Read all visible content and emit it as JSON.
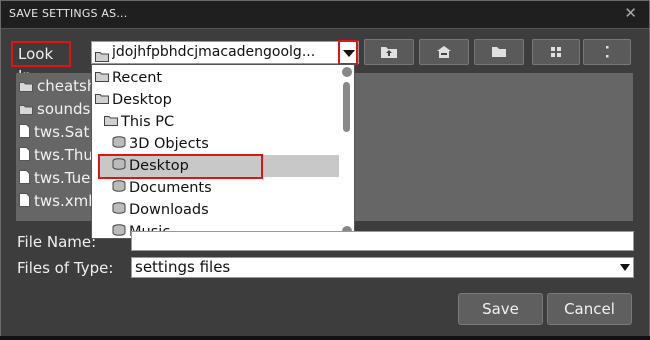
{
  "dialog": {
    "title": "SAVE SETTINGS AS...",
    "close_glyph": "✕"
  },
  "lookin": {
    "label": "Look In:",
    "value": "jdojhfpbhdcjmacadengoolg..."
  },
  "files": [
    {
      "name": "cheatsh",
      "type": "folder"
    },
    {
      "name": "sounds",
      "type": "folder"
    },
    {
      "name": "tws.Sat",
      "type": "file"
    },
    {
      "name": "tws.Thu",
      "type": "file"
    },
    {
      "name": "tws.Tue",
      "type": "file"
    },
    {
      "name": "tws.xml",
      "type": "file"
    }
  ],
  "dropdown": {
    "items": [
      {
        "label": "Recent",
        "icon": "folder-icon"
      },
      {
        "label": "Desktop",
        "icon": "folder-icon"
      },
      {
        "label": "This PC",
        "icon": "folder-icon"
      },
      {
        "label": "3D Objects",
        "icon": "drive-icon"
      },
      {
        "label": "Desktop",
        "icon": "drive-icon"
      },
      {
        "label": "Documents",
        "icon": "drive-icon"
      },
      {
        "label": "Downloads",
        "icon": "drive-icon"
      },
      {
        "label": "Music",
        "icon": "drive-icon"
      }
    ],
    "selected": "Desktop"
  },
  "filename": {
    "label": "File Name:",
    "value": ""
  },
  "filetype": {
    "label": "Files of Type:",
    "value": "settings files"
  },
  "buttons": {
    "save": "Save",
    "cancel": "Cancel"
  },
  "colors": {
    "highlight_red": "#e01414",
    "dialog_bg": "#3d3d3d",
    "pane_bg": "#666666"
  }
}
